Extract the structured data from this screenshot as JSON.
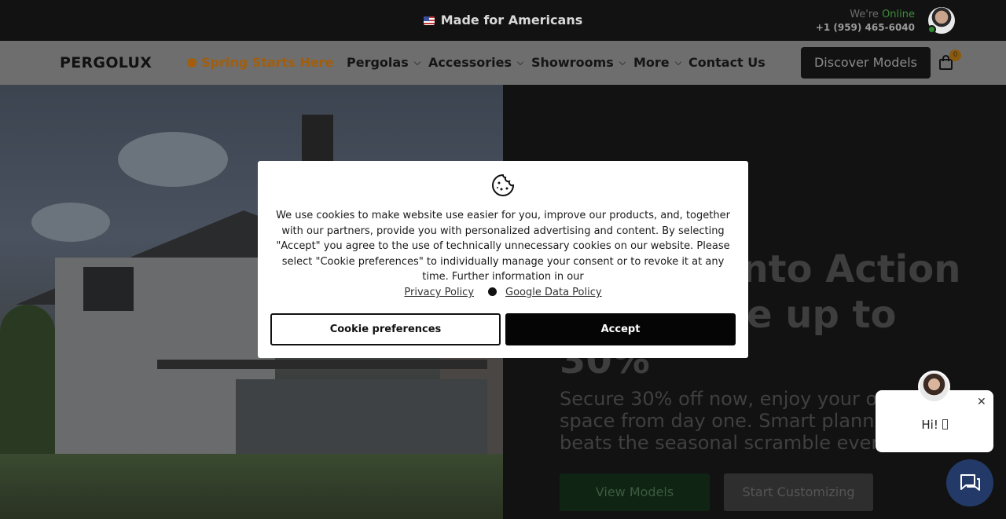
{
  "topbar": {
    "made_for": "Made for Americans",
    "we_are": "We're",
    "online": "Online",
    "phone": "+1 (959) 465-6040"
  },
  "nav": {
    "logo": "PERGOLUX",
    "items": [
      {
        "label": "Spring Starts Here"
      },
      {
        "label": "Pergolas"
      },
      {
        "label": "Accessories"
      },
      {
        "label": "Showrooms"
      },
      {
        "label": "More"
      },
      {
        "label": "Contact Us"
      }
    ],
    "cta": "Discover Models",
    "cart_count": "0"
  },
  "hero": {
    "title_line1": "into Action",
    "title_line2": "e up to",
    "title_line3": "30%",
    "subtitle": "Secure 30% off now, enjoy your o space from day one. Smart plann beats the seasonal scramble ever",
    "btn_view": "View Models",
    "btn_customize": "Start Customizing"
  },
  "cookie": {
    "text": "We use cookies to make website use easier for you, improve our products, and, together with our partners, provide you with personalized advertising and content. By selecting \"Accept\" you agree to the use of technically unnecessary cookies on our website. Please select \"Cookie preferences\" to individually manage your consent or to revoke it at any time. Further information in our",
    "privacy_link": "Privacy Policy",
    "google_link": "Google Data Policy",
    "btn_preferences": "Cookie preferences",
    "btn_accept": "Accept"
  },
  "chat": {
    "greeting": "Hi! ",
    "close": "✕"
  },
  "colors": {
    "accent_green": "#0f2413",
    "chat_blue": "#233a68",
    "spring_orange": "#a25e0d"
  }
}
